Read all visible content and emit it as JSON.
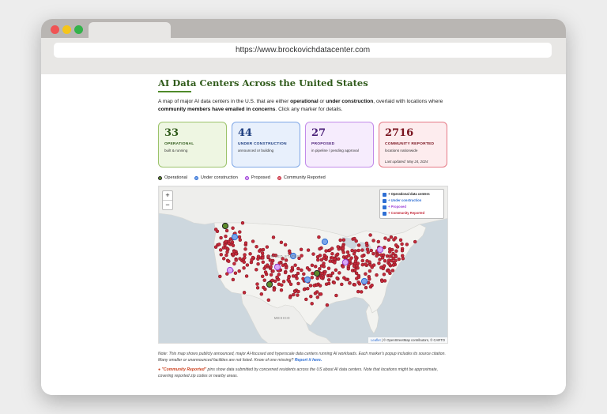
{
  "browser": {
    "url": "https://www.brockovichdatacenter.com",
    "traffic_lights": [
      "#f05454",
      "#f5c51a",
      "#33b24a"
    ]
  },
  "page": {
    "title": "AI Data Centers Across the United States",
    "intro_pre": "A map of major AI data centers in the U.S. that are either ",
    "intro_b1": "operational",
    "intro_mid": " or ",
    "intro_b2": "under construction",
    "intro_mid2": ", overlaid with locations where ",
    "intro_b3": "community members have emailed in concerns",
    "intro_post": ". Click any marker for details."
  },
  "cards": [
    {
      "value": "33",
      "label": "OPERATIONAL",
      "sub": "built & running",
      "border": "#9cc36b",
      "bg": "#eef6e2",
      "color": "#2f5a1a"
    },
    {
      "value": "44",
      "label": "UNDER CONSTRUCTION",
      "sub": "announced or building",
      "border": "#7fa7e6",
      "bg": "#e8f0fc",
      "color": "#1f3f80"
    },
    {
      "value": "27",
      "label": "PROPOSED",
      "sub": "in pipeline / pending approval",
      "border": "#c28bea",
      "bg": "#f6ecfd",
      "color": "#4a1f78"
    },
    {
      "value": "2716",
      "label": "COMMUNITY REPORTED",
      "sub": "locations nationwide",
      "updated": "Last updated: May 24, 2024",
      "border": "#e57a86",
      "bg": "#fdecee",
      "color": "#7a1520"
    }
  ],
  "legend": [
    {
      "label": "Operational",
      "color": "#222222",
      "fill": "#5c8a2a"
    },
    {
      "label": "Under construction",
      "color": "#2f6fd4",
      "fill": "#7aa5ea"
    },
    {
      "label": "Proposed",
      "color": "#9b3fd6",
      "fill": "#d9a8f5"
    },
    {
      "label": "Community Reported",
      "color": "#c42a3a",
      "fill": "#e67a86"
    }
  ],
  "map": {
    "zoom_in": "+",
    "zoom_out": "−",
    "layers": [
      {
        "label": "+ Operational data centers",
        "color": "#222222"
      },
      {
        "label": "+ Under construction",
        "color": "#2f6fd4"
      },
      {
        "label": "+ Proposed",
        "color": "#9b3fd6"
      },
      {
        "label": "+ Community Reported",
        "color": "#c42a3a"
      }
    ],
    "label_us": "UNITED STATES",
    "label_mexico": "MEXICO",
    "attribution_leaflet": "Leaflet",
    "attribution_rest": " | © OpenStreetMap contributors, © CARTO"
  },
  "notes": {
    "note_text": "Note: This map shows publicly announced, major AI-focused and hyperscale data centers running AI workloads. Each marker's popup includes its source citation. Many smaller or unannounced facilities are not listed. Know of one missing? ",
    "note_link": "Report it here.",
    "note2_bullet": "●",
    "note2_bold": "\"Community Reported\"",
    "note2_text": " pins show data submitted by concerned residents across the US about AI data centers. Note that locations might be approximate, covering reported zip codes or nearby areas."
  }
}
